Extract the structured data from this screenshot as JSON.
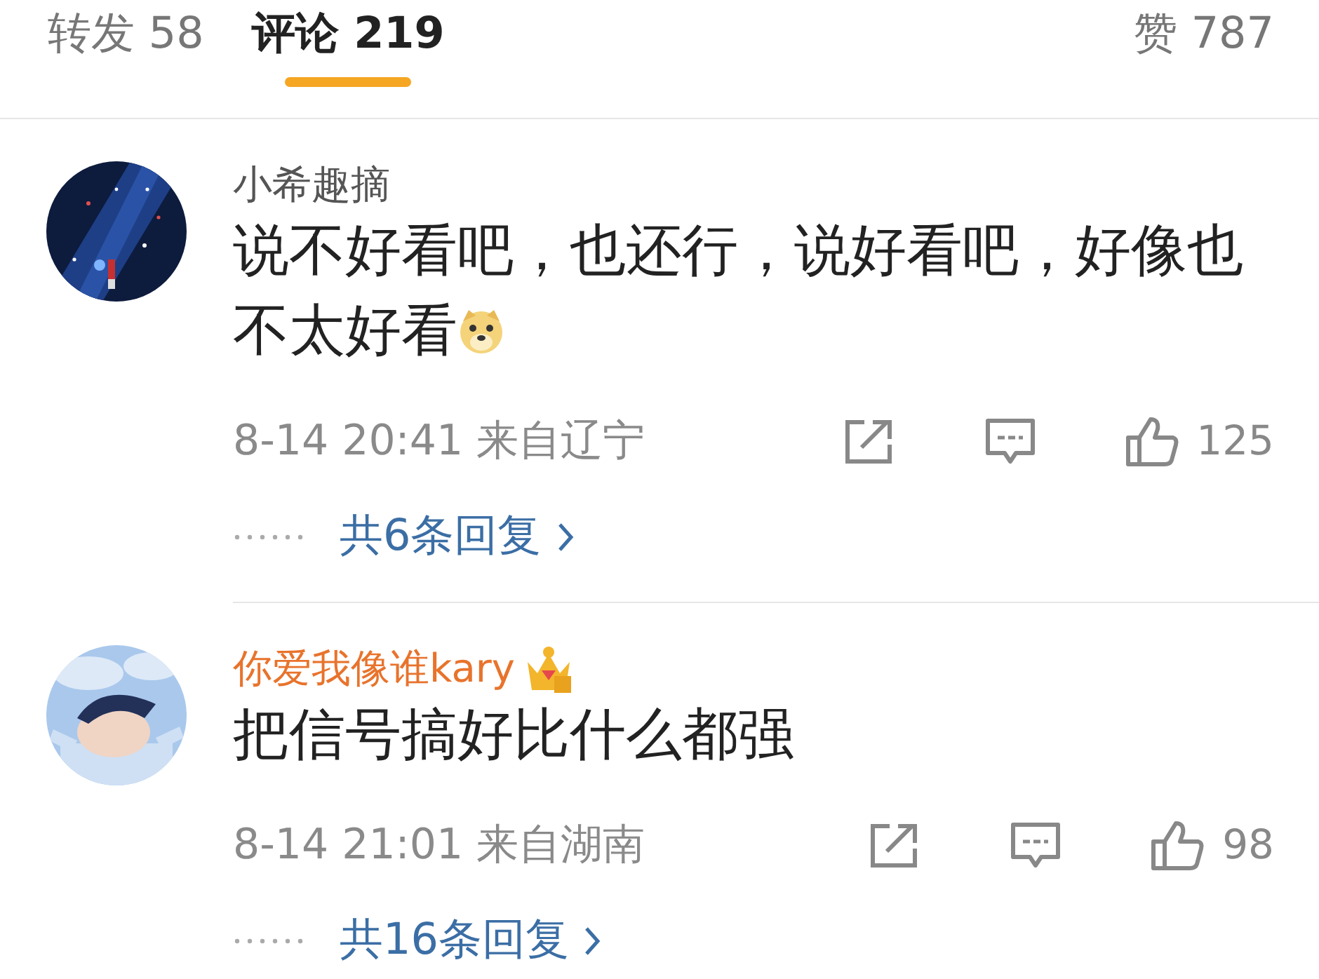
{
  "tabs": [
    {
      "label": "转发",
      "count": "58",
      "selected": false
    },
    {
      "label": "评论",
      "count": "219",
      "selected": true
    },
    {
      "label": "赞",
      "count": "787",
      "selected": false
    }
  ],
  "comments": [
    {
      "username": "小希趣摘",
      "color": "#555555",
      "vip": false,
      "text": "说不好看吧，也还行，说好看吧，好像也不太好看",
      "emoji": true,
      "date": "8-14 20:41",
      "location": "来自辽宁",
      "likes": "125",
      "replies": "共6条回复"
    },
    {
      "username": "你爱我像谁kary",
      "color": "#e8732c",
      "vip": true,
      "text": "把信号搞好比什么都强",
      "emoji": false,
      "date": "8-14 21:01",
      "location": "来自湖南",
      "likes": "98",
      "replies": "共16条回复"
    }
  ]
}
